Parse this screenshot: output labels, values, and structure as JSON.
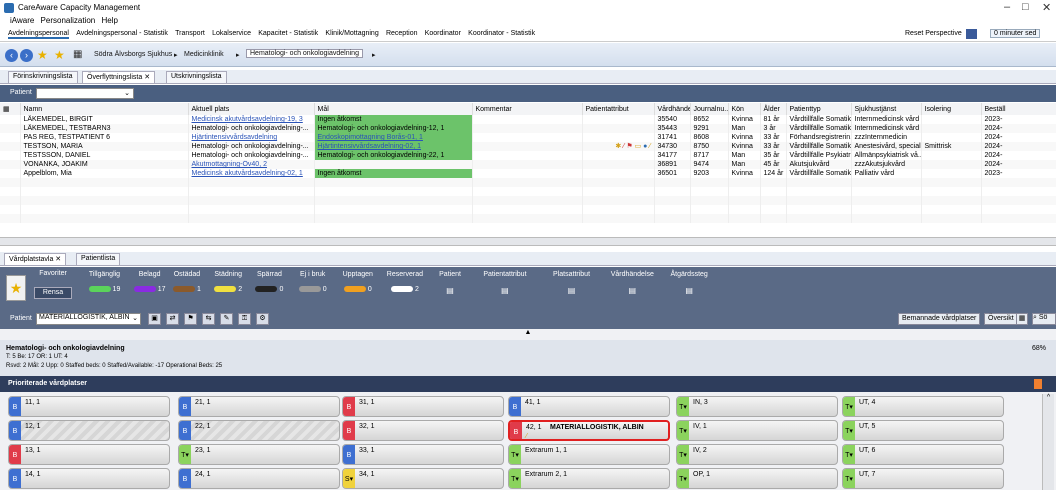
{
  "window": {
    "title": "CareAware Capacity Management",
    "controls": [
      "–",
      "□",
      "✕"
    ]
  },
  "menu": [
    "iAware",
    "Personalization",
    "Help"
  ],
  "nav": {
    "links": [
      "Avdelningspersonal",
      "Avdelningspersonal - Statistik",
      "Transport",
      "Lokalservice",
      "Kapacitet - Statistik",
      "Klinik/Mottagning",
      "Reception",
      "Koordinator",
      "Koordinator - Statistik"
    ],
    "reset": "Reset Perspective",
    "minutes": "0 minuter sed"
  },
  "breadcrumb": [
    "Södra Älvsborgs Sjukhus",
    "Medicinklinik",
    "Hematologi- och onkologiavdelning"
  ],
  "top_tabs": [
    "Förinskrivningslista",
    "Överflyttningslista",
    "Utskrivningslista"
  ],
  "patient_filter": {
    "label": "Patient"
  },
  "columns": [
    "Namn",
    "Aktuell plats",
    "Mål",
    "Kommentar",
    "Patientattribut",
    "Vårdhändel...",
    "Journalnu...",
    "Kön",
    "Ålder",
    "Patienttyp",
    "Sjukhustjänst",
    "Isolering",
    "Beställ"
  ],
  "rows": [
    {
      "name": "LÄKEMEDEL, BIRGIT",
      "place": "Medicinsk akutvårdsavdelning-19, 3",
      "goal": "Ingen åtkomst",
      "attr": "",
      "vh": "35540",
      "journal": "8652",
      "sex": "Kvinna",
      "age": "81 år",
      "type": "Vårdtillfälle Somatik",
      "service": "Internmedicinsk vård",
      "iso": "",
      "order": "2023-"
    },
    {
      "name": "LÄKEMEDEL, TESTBARN3",
      "place": "Hematologi- och onkologiavdelning-...",
      "goal": "Hematologi- och onkologiavdelning-12, 1",
      "attr": "",
      "vh": "35443",
      "journal": "9291",
      "sex": "Man",
      "age": "3 år",
      "type": "Vårdtillfälle Somatik",
      "service": "Internmedicinsk vård",
      "iso": "",
      "order": "2024-"
    },
    {
      "name": "PAS REG, TESTPATIENT 6",
      "place": "Hjärtintensivvårdsavdelning",
      "goal": "Endoskopimottagning Borås-01, 1",
      "attr": "",
      "vh": "31741",
      "journal": "8608",
      "sex": "Kvinna",
      "age": "33 år",
      "type": "Förhandsregistrerin...",
      "service": "zzzInternmedicin",
      "iso": "",
      "order": "2024-"
    },
    {
      "name": "TESTSON, MARIA",
      "place": "Hematologi- och onkologiavdelning-...",
      "goal": "Hjärtintensivvårdsavdelning-02, 1",
      "attr": "icons",
      "vh": "34730",
      "journal": "8750",
      "sex": "Kvinna",
      "age": "33 år",
      "type": "Vårdtillfälle Somatik",
      "service": "Anestesivård, special",
      "iso": "Smittrisk",
      "order": "2024-"
    },
    {
      "name": "TESTSSON, DANIEL",
      "place": "Hematologi- och onkologiavdelning-...",
      "goal": "Hematologi- och onkologiavdelning-22, 1",
      "attr": "",
      "vh": "34177",
      "journal": "8717",
      "sex": "Man",
      "age": "35 år",
      "type": "Vårdtillfälle Psykiatri",
      "service": "Allmänpsykiatrisk vå...",
      "iso": "",
      "order": "2024-"
    },
    {
      "name": "VONANKA, JOAKIM",
      "place": "Akutmottagning-Öv40, 2",
      "goal": "",
      "attr": "",
      "vh": "36891",
      "journal": "9474",
      "sex": "Man",
      "age": "45 år",
      "type": "Akutsjukvård",
      "service": "zzzAkutsjukvård",
      "iso": "",
      "order": "2024-"
    },
    {
      "name": "Appelblom, Mia",
      "place": "Medicinsk akutvårdsavdelning-02, 1",
      "goal": "Ingen åtkomst",
      "attr": "",
      "vh": "36501",
      "journal": "9203",
      "sex": "Kvinna",
      "age": "124 år",
      "type": "Vårdtillfälle Somatik",
      "service": "Palliativ vård",
      "iso": "",
      "order": "2023-"
    }
  ],
  "bottom_tabs": [
    "Vårdplatstavla",
    "Patientlista"
  ],
  "filters": {
    "favorites": "Favoriter",
    "clear": "Rensa",
    "items": [
      {
        "label": "Tillgänglig",
        "count": "19",
        "color": "#5bd35b"
      },
      {
        "label": "Belagd",
        "count": "17",
        "color": "#8a2be2"
      },
      {
        "label": "Ostädad",
        "count": "1",
        "color": "#8b5a2b"
      },
      {
        "label": "Städning",
        "count": "2",
        "color": "#f0e040"
      },
      {
        "label": "Spärrad",
        "count": "0",
        "color": "#222222"
      },
      {
        "label": "Ej i bruk",
        "count": "0",
        "color": "#999999"
      },
      {
        "label": "Upptagen",
        "count": "0",
        "color": "#f0a020"
      },
      {
        "label": "Reserverad",
        "count": "2",
        "color": "#ffffff"
      },
      {
        "label": "Patient",
        "count": "",
        "color": ""
      },
      {
        "label": "Patientattribut",
        "count": "",
        "color": ""
      },
      {
        "label": "Platsattribut",
        "count": "",
        "color": ""
      },
      {
        "label": "Vårdhändelse",
        "count": "",
        "color": ""
      },
      {
        "label": "Åtgärdssteg",
        "count": "",
        "color": ""
      }
    ]
  },
  "patient_bar": {
    "label": "Patient",
    "value": "MATERIALLOGISTIK, ALBIN",
    "named_button": "Bemannade vårdplatser",
    "overview": "Översikt",
    "search": "Sö"
  },
  "department": {
    "name": "Hematologi- och onkologiavdelning",
    "stats1": "T: 5 Be: 17 OR: 1 UT: 4",
    "stats2": "Rsvd: 2 Mål: 2 Upp: 0 Staffed beds: 0 Staffed/Available: -17 Operational Beds: 25",
    "percent": "68%"
  },
  "board": {
    "title": "Prioriterade vårdplatser",
    "beds": [
      [
        {
          "label": "11, 1",
          "t": "B"
        },
        {
          "label": "21, 1",
          "t": "B"
        },
        {
          "label": "31, 1",
          "t": "R"
        },
        {
          "label": "41, 1",
          "t": "B"
        },
        {
          "label": "IN, 3",
          "t": "G"
        },
        {
          "label": "UT, 4",
          "t": "G"
        }
      ],
      [
        {
          "label": "12, 1",
          "t": "B",
          "hatch": true
        },
        {
          "label": "22, 1",
          "t": "B",
          "hatch": true
        },
        {
          "label": "32, 1",
          "t": "R"
        },
        {
          "label": "42, 1",
          "t": "R",
          "patient": "MATERIALLOGISTIK, ALBIN",
          "sel": true
        },
        {
          "label": "IV, 1",
          "t": "G"
        },
        {
          "label": "UT, 5",
          "t": "G"
        }
      ],
      [
        {
          "label": "13, 1",
          "t": "R"
        },
        {
          "label": "23, 1",
          "t": "G"
        },
        {
          "label": "33, 1",
          "t": "B"
        },
        {
          "label": "Extrarum 1, 1",
          "t": "G"
        },
        {
          "label": "IV, 2",
          "t": "G"
        },
        {
          "label": "UT, 6",
          "t": "G"
        }
      ],
      [
        {
          "label": "14, 1",
          "t": "B"
        },
        {
          "label": "24, 1",
          "t": "B"
        },
        {
          "label": "34, 1",
          "t": "Y"
        },
        {
          "label": "Extrarum 2, 1",
          "t": "G"
        },
        {
          "label": "OP, 1",
          "t": "G"
        },
        {
          "label": "UT, 7",
          "t": "G"
        }
      ]
    ]
  }
}
